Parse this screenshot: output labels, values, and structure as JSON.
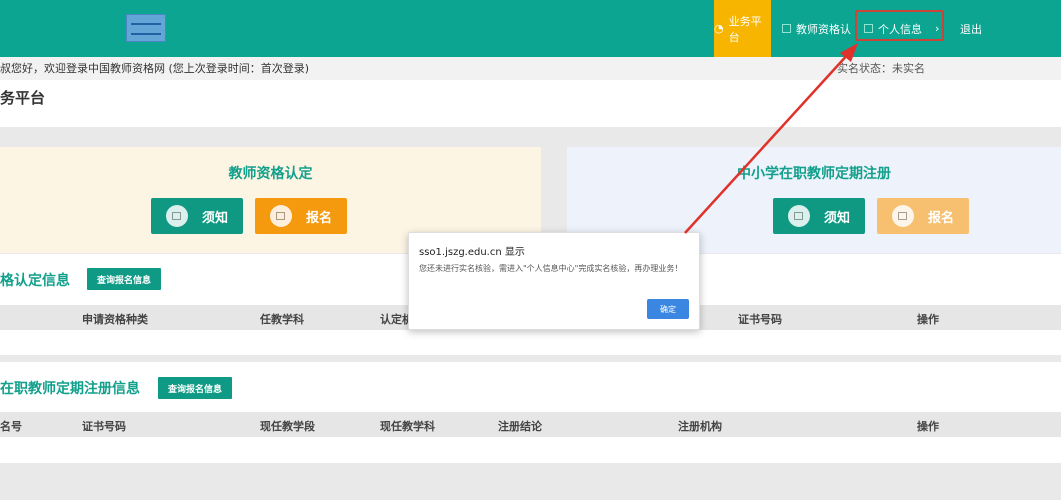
{
  "header": {
    "nav": [
      {
        "label": "业务平台",
        "icon": "chat-icon"
      },
      {
        "label": "教师资格认"
      },
      {
        "label": "个人信息"
      },
      {
        "label": "退出"
      }
    ]
  },
  "greeting": "叔您好，欢迎登录中国教师资格网 (您上次登录时间：首次登录)",
  "realname_status": "实名状态：未实名",
  "page_title": "务平台",
  "cards": [
    {
      "title": "教师资格认定",
      "notice": "须知",
      "signup": "报名"
    },
    {
      "title": "中小学在职教师定期注册",
      "notice": "须知",
      "signup": "报名"
    }
  ],
  "section1": {
    "title": "格认定信息",
    "query": "查询报名信息",
    "columns": [
      "申请资格种类",
      "任教学科",
      "认定机",
      "证书号码",
      "操作"
    ]
  },
  "section2": {
    "title": "在职教师定期注册信息",
    "query": "查询报名信息",
    "columns": [
      "名号",
      "证书号码",
      "现任教学段",
      "现任教学科",
      "注册结论",
      "注册机构",
      "操作"
    ]
  },
  "dialog": {
    "title": "sso1.jszg.edu.cn 显示",
    "message": "您还未进行实名核验，需进入\"个人信息中心\"完成实名核验，再办理业务！",
    "ok": "确定"
  },
  "colors": {
    "header": "#0ba592",
    "accent": "#f8b500",
    "annotation": "#e0312a"
  }
}
